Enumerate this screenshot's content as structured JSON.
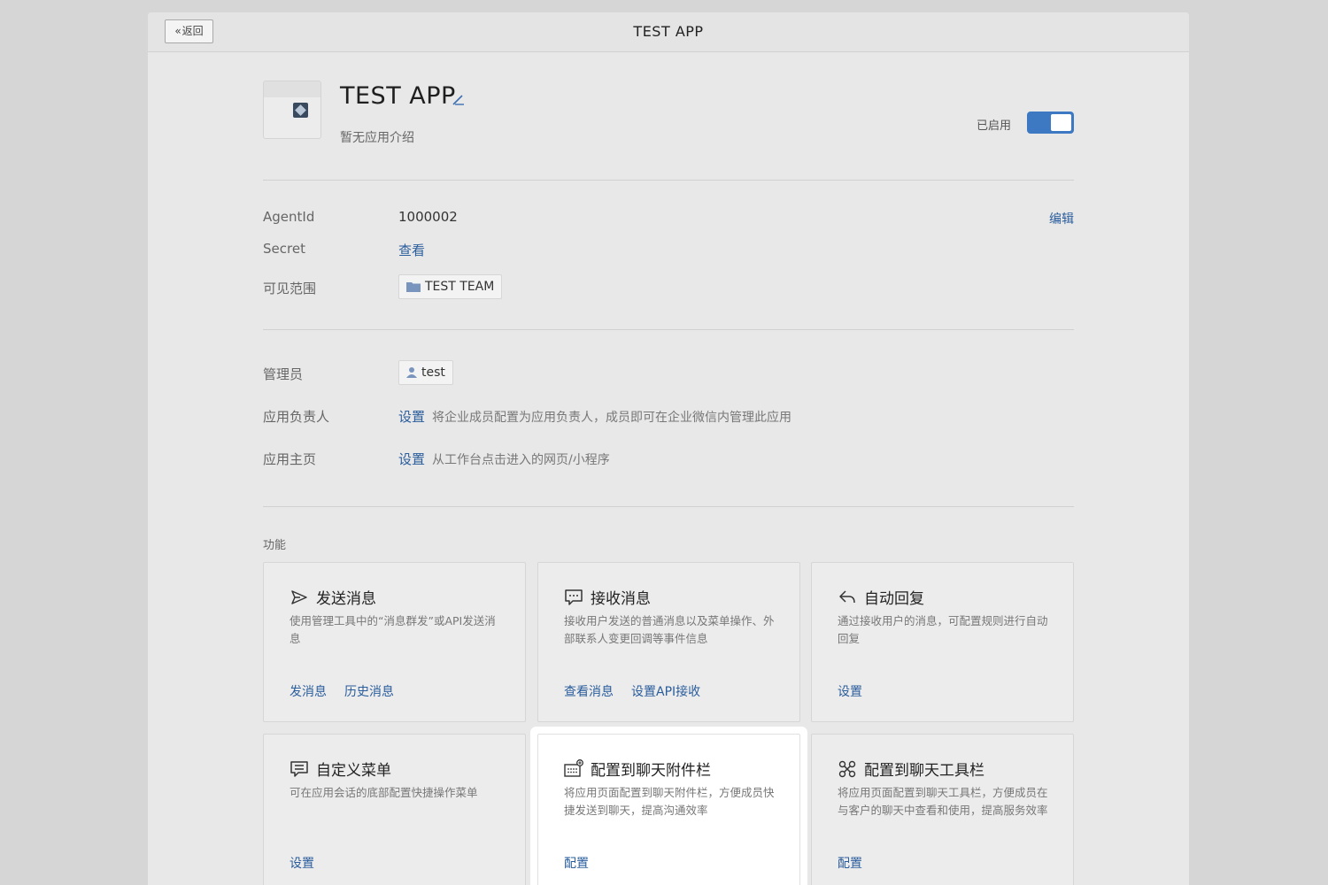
{
  "window": {
    "title": "TEST APP",
    "back_label": "返回",
    "back_chevron": "«"
  },
  "app": {
    "name": "TEST APP",
    "description": "暂无应用介绍",
    "status_label": "已启用",
    "enabled": true
  },
  "info": {
    "agentid_label": "AgentId",
    "agentid_value": "1000002",
    "edit_label": "编辑",
    "secret_label": "Secret",
    "secret_link": "查看",
    "visibility_label": "可见范围",
    "visibility_team": "TEST TEAM"
  },
  "admin": {
    "admin_label": "管理员",
    "admin_value": "test",
    "owner_label": "应用负责人",
    "owner_link": "设置",
    "owner_hint": "将企业成员配置为应用负责人，成员即可在企业微信内管理此应用",
    "homepage_label": "应用主页",
    "homepage_link": "设置",
    "homepage_hint": "从工作台点击进入的网页/小程序"
  },
  "features": {
    "section_title": "功能",
    "cards": [
      {
        "icon": "send-icon",
        "title": "发送消息",
        "desc": "使用管理工具中的“消息群发”或API发送消息",
        "actions": [
          "发消息",
          "历史消息"
        ]
      },
      {
        "icon": "message-icon",
        "title": "接收消息",
        "desc": "接收用户发送的普通消息以及菜单操作、外部联系人变更回调等事件信息",
        "actions": [
          "查看消息",
          "设置API接收"
        ]
      },
      {
        "icon": "reply-icon",
        "title": "自动回复",
        "desc": "通过接收用户的消息，可配置规则进行自动回复",
        "actions": [
          "设置"
        ]
      },
      {
        "icon": "menu-icon",
        "title": "自定义菜单",
        "desc": "可在应用会话的底部配置快捷操作菜单",
        "actions": [
          "设置"
        ]
      },
      {
        "icon": "attachment-bar-icon",
        "title": "配置到聊天附件栏",
        "desc": "将应用页面配置到聊天附件栏，方便成员快捷发送到聊天，提高沟通效率",
        "actions": [
          "配置"
        ]
      },
      {
        "icon": "toolbar-icon",
        "title": "配置到聊天工具栏",
        "desc": "将应用页面配置到聊天工具栏，方便成员在与客户的聊天中查看和使用，提高服务效率",
        "actions": [
          "配置"
        ]
      }
    ]
  },
  "colors": {
    "link": "#2a5d9c",
    "toggle_on": "#3d78c2"
  }
}
